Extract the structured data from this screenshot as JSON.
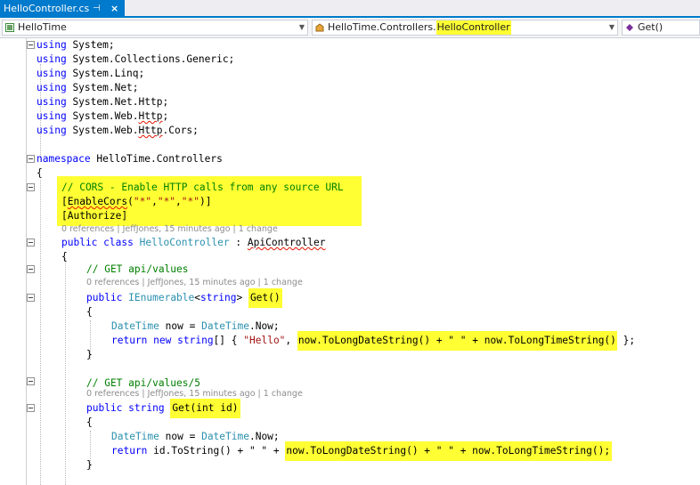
{
  "tab": {
    "title": "HelloController.cs",
    "pin": "⊣",
    "close": "×"
  },
  "nav": {
    "project": "HelloTime",
    "type_prefix": "HelloTime.Controllers.",
    "type_name": "HelloController",
    "member": "Get()"
  },
  "code": {
    "using_kw": "using",
    "usings": [
      "System;",
      "System.Collections.Generic;",
      "System.Linq;",
      "System.Net;",
      "System.Net.Http;"
    ],
    "u6a": "System.Web.",
    "u6b": "Http",
    "u6c": ";",
    "u7a": "System.Web.",
    "u7b": "Http",
    "u7c": ".Cors;",
    "namespace_kw": "namespace",
    "namespace_name": "HelloTime.Controllers",
    "open_brace": "{",
    "close_brace": "}",
    "cors_comment": "// CORS - Enable HTTP calls from any source URL",
    "attr_open": "[",
    "enablecors": "EnableCors",
    "attr_args_open": "(",
    "star": "\"*\"",
    "comma": ",",
    "attr_args_close": ")]",
    "authorize": "[Authorize]",
    "public_kw": "public",
    "class_kw": "class",
    "class_name": "HelloController",
    "colon": ":",
    "base_class": "ApiController",
    "get_comment": "// GET api/values",
    "ienumerable": "IEnumerable",
    "lt": "<",
    "string_kw": "string",
    "gt": ">",
    "get_sig": "Get()",
    "datetime": "DateTime",
    "now_assign": "now =",
    "now_prop": ".Now;",
    "return_kw": "return",
    "new_kw": "new",
    "array_open": "[] {",
    "hello": "\"Hello\"",
    "expr1": "now.ToLongDateString() + \" \" + now.ToLongTimeString()",
    "array_close": "};",
    "get5_comment": "// GET api/values/5",
    "get_id_sig": "Get(int id)",
    "return2_pre": "id.ToString() + \" \" +",
    "expr2": "now.ToLongDateString() + \" \" + now.ToLongTimeString();"
  },
  "codelens": {
    "class_info": "0 references | JeffJones, 15 minutes ago | 1 change",
    "get_info": "0 references | JeffJones, 15 minutes ago | 1 change",
    "get_id_info": "0 references | JeffJones, 15 minutes ago | 1 change"
  },
  "colors": {
    "keyword": "#0000ff",
    "type": "#2b91af",
    "string": "#a31515",
    "comment": "#008000",
    "highlight": "#ffff33",
    "tab_active": "#007acc"
  }
}
